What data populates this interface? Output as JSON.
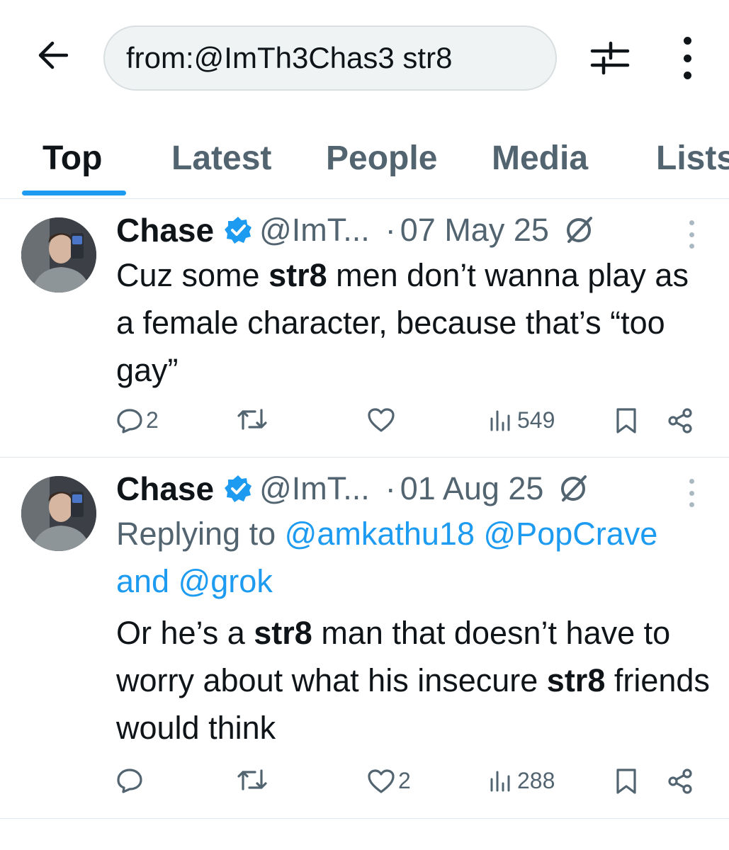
{
  "search": {
    "query": "from:@ImTh3Chas3 str8"
  },
  "tabs": [
    {
      "label": "Top",
      "active": true
    },
    {
      "label": "Latest",
      "active": false
    },
    {
      "label": "People",
      "active": false
    },
    {
      "label": "Media",
      "active": false
    },
    {
      "label": "Lists",
      "active": false
    }
  ],
  "tweets": [
    {
      "author_name": "Chase",
      "handle": "@ImT...",
      "separator": "·",
      "date": "07 May 25",
      "text_parts": [
        {
          "t": "Cuz some ",
          "bold": false
        },
        {
          "t": "str8",
          "bold": true
        },
        {
          "t": " men don’t wanna play as a female character, because that’s “too gay”",
          "bold": false
        }
      ],
      "replies": "2",
      "reposts": "",
      "likes": "",
      "views": "549"
    },
    {
      "author_name": "Chase",
      "handle": "@ImT...",
      "separator": "·",
      "date": "01 Aug 25",
      "replying_prefix": "Replying to ",
      "replying_mention_1": "@amkathu18",
      "replying_mention_2": "@PopCrave",
      "replying_and": " and ",
      "replying_mention_3": "@grok",
      "text_parts": [
        {
          "t": "Or he’s a ",
          "bold": false
        },
        {
          "t": "str8",
          "bold": true
        },
        {
          "t": " man that doesn’t have to worry about what his insecure ",
          "bold": false
        },
        {
          "t": "str8",
          "bold": true
        },
        {
          "t": " friends would think",
          "bold": false
        }
      ],
      "replies": "",
      "reposts": "",
      "likes": "2",
      "views": "288"
    }
  ],
  "colors": {
    "accent": "#1d9bf0",
    "text": "#0f1419",
    "secondary": "#536471"
  },
  "icons": [
    "back-arrow-icon",
    "filter-icon",
    "more-vertical-icon",
    "verified-badge-icon",
    "muted-icon",
    "reply-icon",
    "repost-icon",
    "like-icon",
    "views-icon",
    "bookmark-icon",
    "share-icon"
  ]
}
